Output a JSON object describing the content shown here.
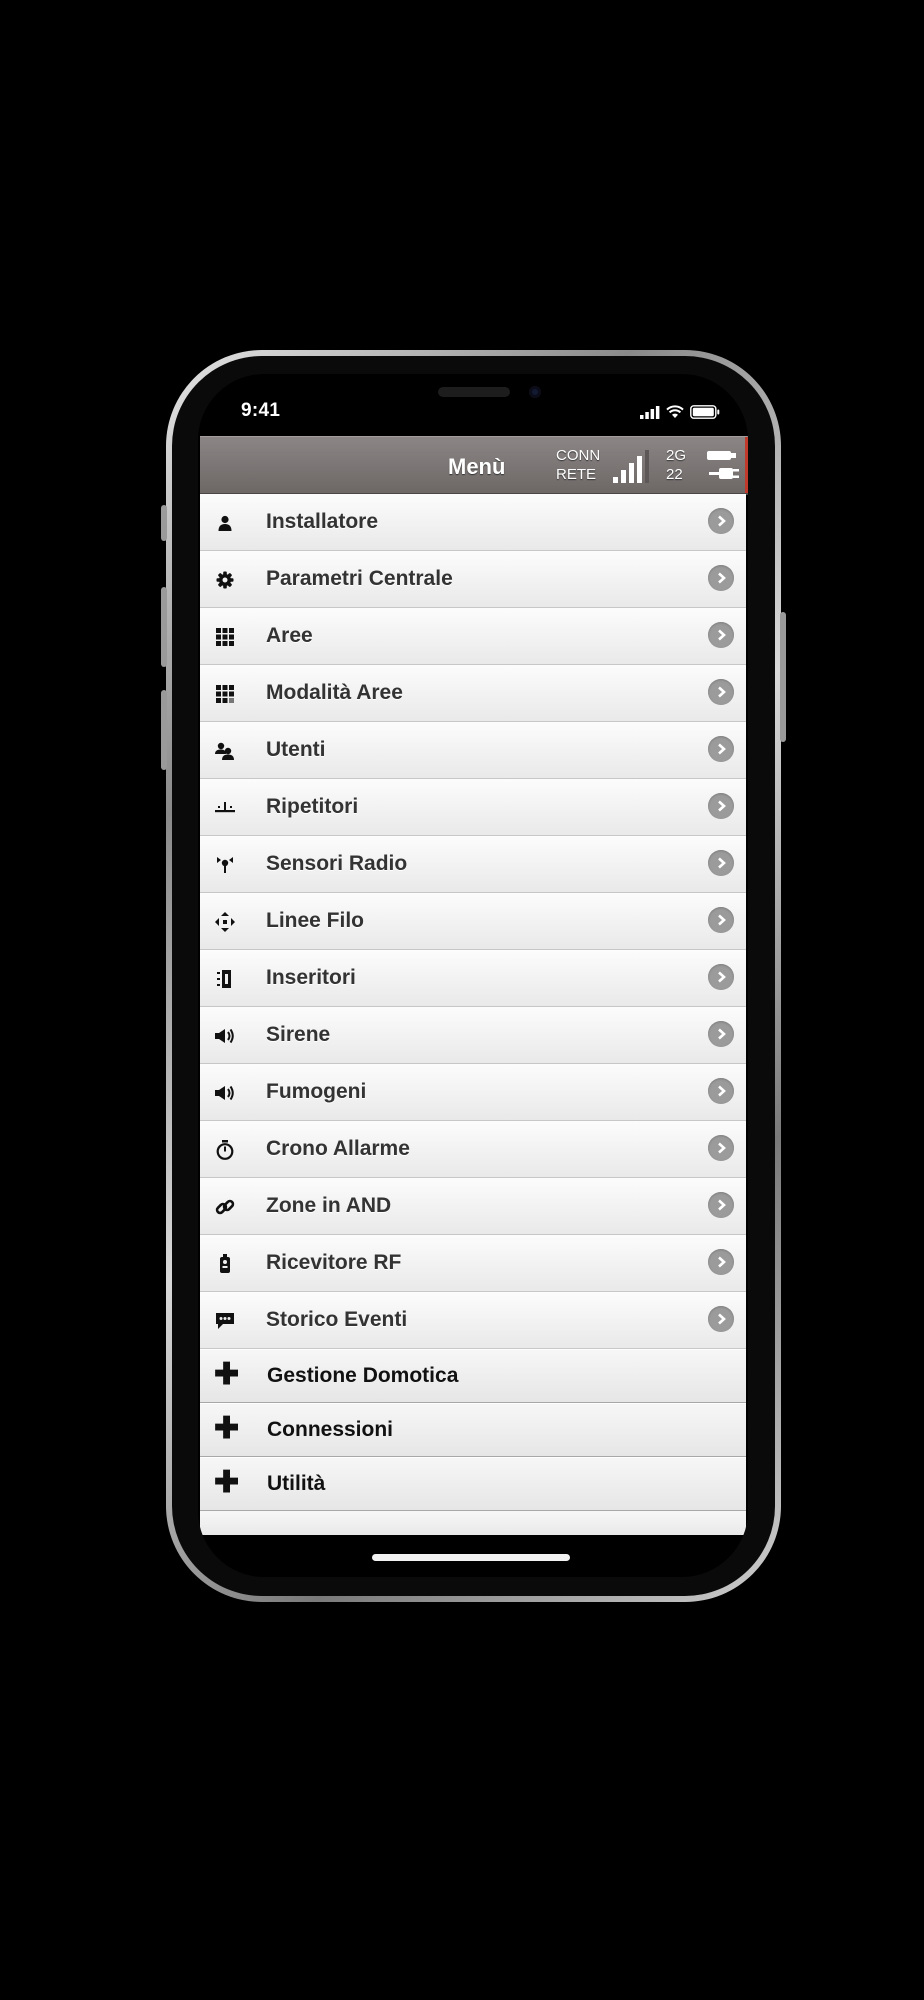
{
  "status_bar": {
    "time": "9:41"
  },
  "app_bar": {
    "title": "Menù",
    "conn_line1": "CONN",
    "conn_line2": "RETE",
    "network_line1": "2G",
    "network_line2": "22"
  },
  "menu": {
    "items": [
      {
        "label": "Installatore",
        "icon": "user-icon"
      },
      {
        "label": "Parametri Centrale",
        "icon": "gear-icon"
      },
      {
        "label": "Aree",
        "icon": "grid-icon"
      },
      {
        "label": "Modalità Aree",
        "icon": "grid-icon"
      },
      {
        "label": "Utenti",
        "icon": "users-icon"
      },
      {
        "label": "Ripetitori",
        "icon": "repeater-icon"
      },
      {
        "label": "Sensori Radio",
        "icon": "radio-sensor-icon"
      },
      {
        "label": "Linee Filo",
        "icon": "wired-lines-icon"
      },
      {
        "label": "Inseritori",
        "icon": "inserter-icon"
      },
      {
        "label": "Sirene",
        "icon": "speaker-icon"
      },
      {
        "label": "Fumogeni",
        "icon": "speaker-icon"
      },
      {
        "label": "Crono Allarme",
        "icon": "stopwatch-icon"
      },
      {
        "label": "Zone in AND",
        "icon": "link-icon"
      },
      {
        "label": "Ricevitore RF",
        "icon": "remote-icon"
      },
      {
        "label": "Storico Eventi",
        "icon": "comment-icon"
      }
    ],
    "expandables": [
      {
        "label": "Gestione Domotica"
      },
      {
        "label": "Connessioni"
      },
      {
        "label": "Utilità"
      }
    ]
  },
  "colors": {
    "app_bar": "#7d7877",
    "chevron_button": "#9b9b9b",
    "accent_red": "#c0392b"
  }
}
